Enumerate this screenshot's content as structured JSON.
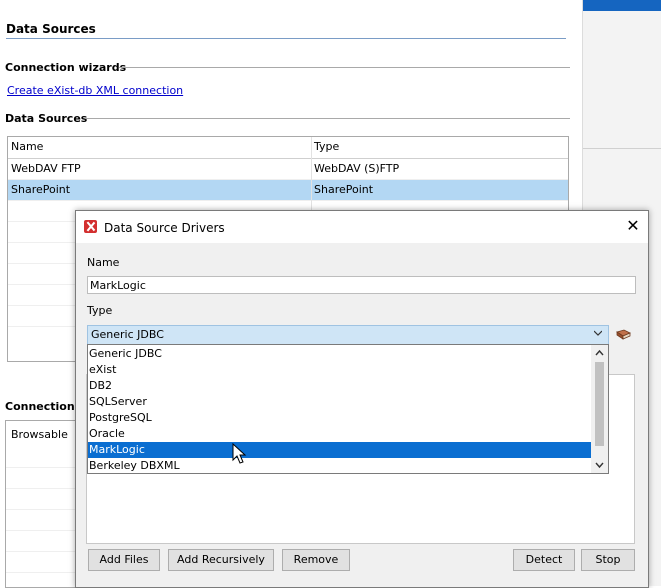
{
  "background": {
    "page_title": "Data Sources",
    "connection_wizards": {
      "heading": "Connection wizards",
      "link": "Create eXist-db XML connection"
    },
    "data_sources": {
      "heading": "Data Sources",
      "columns": [
        "Name",
        "Type"
      ],
      "rows": [
        {
          "name": "WebDAV FTP",
          "type": "WebDAV (S)FTP"
        },
        {
          "name": "SharePoint",
          "type": "SharePoint"
        }
      ],
      "selected_row": 1
    },
    "connections": {
      "heading": "Connections",
      "column": "Browsable"
    }
  },
  "dialog": {
    "title": "Data Source Drivers",
    "name_label": "Name",
    "name_value": "MarkLogic",
    "type_label": "Type",
    "type_value": "Generic JDBC",
    "type_options": [
      "Generic JDBC",
      "eXist",
      "DB2",
      "SQLServer",
      "PostgreSQL",
      "Oracle",
      "MarkLogic",
      "Berkeley DBXML"
    ],
    "highlighted_option": 6,
    "buttons": {
      "add_files": "Add Files",
      "add_recursively": "Add Recursively",
      "remove": "Remove",
      "detect": "Detect",
      "stop": "Stop"
    }
  },
  "colors": {
    "selection_row": "#b3d7f3",
    "list_highlight": "#0a6ed1",
    "combo_bg": "#cfe5f6",
    "link": "#0000cc"
  }
}
